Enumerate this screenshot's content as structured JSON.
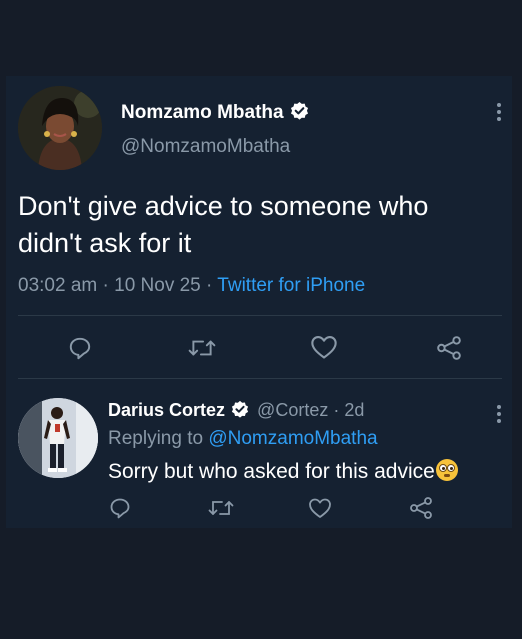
{
  "tweet": {
    "author_name": "Nomzamo Mbatha",
    "author_handle": "@NomzamoMbatha",
    "text": "Don't give advice to someone who didn't ask for it",
    "time": "03:02 am",
    "date": "10 Nov 25",
    "source": "Twitter for iPhone",
    "separator": "·"
  },
  "reply": {
    "author_name": "Darius Cortez",
    "author_handle": "@Cortez",
    "age": "2d",
    "replying_prefix": "Replying to",
    "replying_to": "@NomzamoMbatha",
    "text": "Sorry but who asked for this advice",
    "separator": "·"
  },
  "icons": {
    "verified": "verified-badge-icon",
    "more": "more-vertical-icon",
    "reply": "reply-icon",
    "retweet": "retweet-icon",
    "like": "like-icon",
    "share": "share-icon",
    "emoji": "flushed-face-emoji"
  },
  "colors": {
    "background": "#151c28",
    "card": "#152131",
    "text": "#ffffff",
    "secondary": "#8a99a8",
    "link": "#2f9ef4",
    "divider": "#2b3947"
  }
}
